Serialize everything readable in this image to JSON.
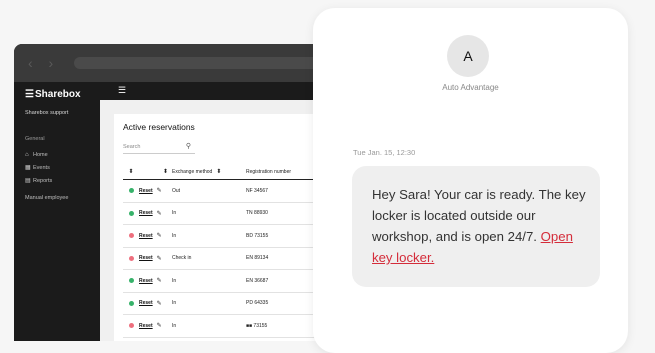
{
  "browser": {
    "nav_glyph": "‹ ›"
  },
  "app": {
    "brand": "Sharebox",
    "org": "Sharebox support",
    "menu_icon": "☰",
    "sidebar": {
      "section": "General",
      "items": [
        {
          "icon": "home-icon",
          "glyph": "⌂",
          "label": "Home"
        },
        {
          "icon": "events-icon",
          "glyph": "▦",
          "label": "Events"
        },
        {
          "icon": "reports-icon",
          "glyph": "▤",
          "label": "Reports"
        }
      ],
      "manual": "Manual employee"
    },
    "panel": {
      "title": "Active reservations",
      "search_placeholder": "Search",
      "table": {
        "headers": [
          "",
          "",
          "Exchange method",
          "Registration number"
        ],
        "rows": [
          {
            "status": "green",
            "action": "Reset",
            "method": "Out",
            "reg": "NF 34567"
          },
          {
            "status": "green",
            "action": "Reset",
            "method": "In",
            "reg": "TN 88930"
          },
          {
            "status": "red",
            "action": "Reset",
            "method": "In",
            "reg": "BD 73155"
          },
          {
            "status": "red",
            "action": "Reset",
            "method": "Check in",
            "reg": "EN 89134"
          },
          {
            "status": "green",
            "action": "Reset",
            "method": "In",
            "reg": "EN 36687"
          },
          {
            "status": "green",
            "action": "Reset",
            "method": "In",
            "reg": "PD 64335"
          },
          {
            "status": "red",
            "action": "Reset",
            "method": "In",
            "reg": "■■ 73155"
          }
        ]
      }
    }
  },
  "message": {
    "avatar_letter": "A",
    "sender": "Auto Advantage",
    "timestamp": "Tue Jan. 15, 12:30",
    "body": "Hey Sara! Your car is ready. The key locker is located outside our workshop, and is open 24/7.",
    "link_text": "Open key locker.",
    "link_color": "#d42c3a"
  },
  "colors": {
    "status_green": "#37b26a",
    "status_red": "#ee6f7e",
    "sidebar_bg": "#1b1b1b",
    "bubble_bg": "#efefef"
  }
}
